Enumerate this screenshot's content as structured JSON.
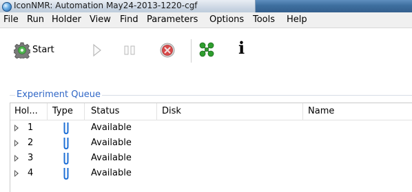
{
  "window": {
    "title": "IconNMR: Automation May24-2013-1220-cgf"
  },
  "menu": [
    "File",
    "Run",
    "Holder",
    "View",
    "Find",
    "Parameters",
    "Options",
    "Tools",
    "Help"
  ],
  "toolbar": {
    "start_label": "Start",
    "info_label": "i",
    "icons": [
      "gear-icon",
      "play-icon",
      "pause-icon",
      "stop-icon",
      "molecule-icon",
      "info-icon"
    ]
  },
  "queue": {
    "group_label": "Experiment Queue",
    "columns": [
      "Hol...",
      "Type",
      "Status",
      "Disk",
      "Name"
    ],
    "rows": [
      {
        "holder": "1",
        "status": "Available"
      },
      {
        "holder": "2",
        "status": "Available"
      },
      {
        "holder": "3",
        "status": "Available"
      },
      {
        "holder": "4",
        "status": "Available"
      }
    ]
  },
  "colors": {
    "group_label": "#2f66c6",
    "tube_icon": "#1e6fd6",
    "stop_icon": "#d94a4a",
    "molecule_icon": "#2e9e2e"
  }
}
